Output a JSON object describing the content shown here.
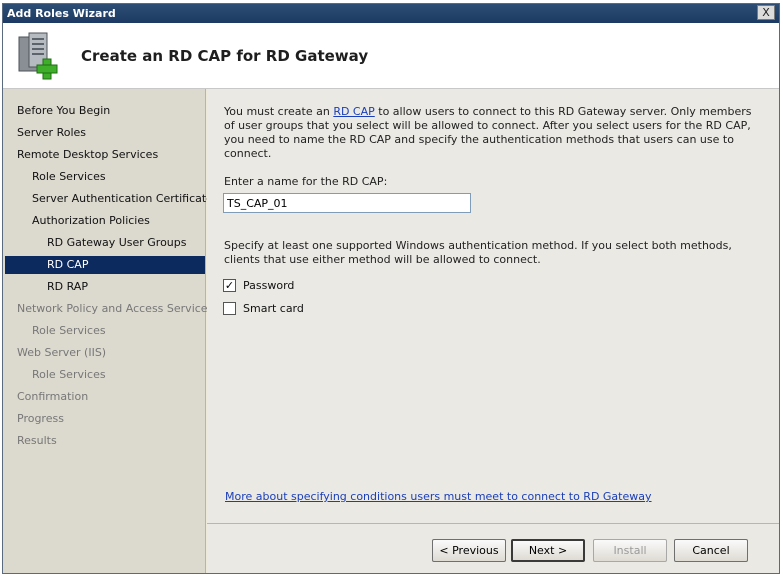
{
  "window": {
    "title": "Add Roles Wizard",
    "close_glyph": "X"
  },
  "header": {
    "title": "Create an RD CAP for RD Gateway",
    "icon": "server-add-icon"
  },
  "nav": {
    "items": [
      {
        "label": "Before You Begin",
        "state": "normal"
      },
      {
        "label": "Server Roles",
        "state": "normal"
      },
      {
        "label": "Remote Desktop Services",
        "state": "normal"
      },
      {
        "label": "Role Services",
        "state": "normal"
      },
      {
        "label": "Server Authentication Certificate",
        "state": "normal"
      },
      {
        "label": "Authorization Policies",
        "state": "normal"
      },
      {
        "label": "RD Gateway User Groups",
        "state": "normal"
      },
      {
        "label": "RD CAP",
        "state": "selected"
      },
      {
        "label": "RD RAP",
        "state": "normal"
      },
      {
        "label": "Network Policy and Access Services",
        "state": "dim"
      },
      {
        "label": "Role Services",
        "state": "dim"
      },
      {
        "label": "Web Server (IIS)",
        "state": "dim"
      },
      {
        "label": "Role Services",
        "state": "dim"
      },
      {
        "label": "Confirmation",
        "state": "dim"
      },
      {
        "label": "Progress",
        "state": "dim"
      },
      {
        "label": "Results",
        "state": "dim"
      }
    ]
  },
  "content": {
    "intro_before_link": "You must create an ",
    "intro_link": "RD CAP",
    "intro_after_link": " to allow users to connect to this RD Gateway server. Only members of user groups that you select will be allowed to connect. After you select users for the RD CAP, you need to name the RD CAP and specify the authentication methods that users can use to connect.",
    "name_label": "Enter a name for the RD CAP:",
    "name_value": "TS_CAP_01",
    "auth_text": "Specify at least one supported Windows authentication method. If you select both methods, clients that use either method will be allowed to connect.",
    "password_label": "Password",
    "password_checked": true,
    "smartcard_label": "Smart card",
    "smartcard_checked": false,
    "more_link": "More about specifying conditions users must meet to connect to RD Gateway"
  },
  "buttons": {
    "previous": "< Previous",
    "next": "Next >",
    "install": "Install",
    "cancel": "Cancel"
  }
}
